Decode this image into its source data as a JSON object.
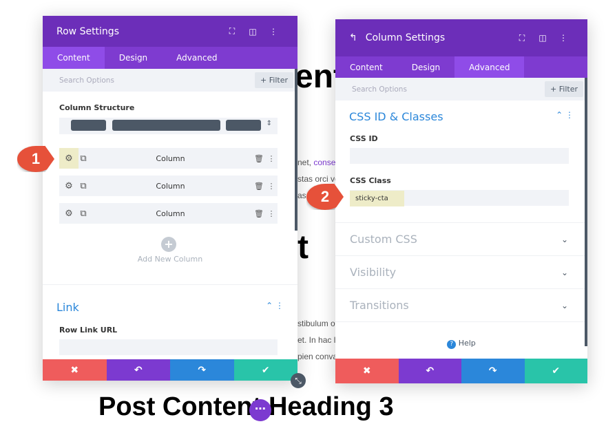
{
  "background": {
    "heading_top": "ent",
    "heading_mid": "t",
    "text_lines": [
      "net, ",
      "conse",
      "stas orci ve",
      "as",
      "stibulum o",
      "et. In hac l",
      "pien conva"
    ],
    "heading_bottom": "Post Content Heading 3"
  },
  "row_settings": {
    "title": "Row Settings",
    "tabs": [
      "Content",
      "Design",
      "Advanced"
    ],
    "search_placeholder": "Search Options",
    "filter": "Filter",
    "column_structure_label": "Column Structure",
    "columns": [
      "Column",
      "Column",
      "Column"
    ],
    "add_column": "Add New Column",
    "link_section": "Link",
    "row_link_url_label": "Row Link URL"
  },
  "column_settings": {
    "title": "Column Settings",
    "tabs": [
      "Content",
      "Design",
      "Advanced"
    ],
    "active_tab": "Advanced",
    "search_placeholder": "Search Options",
    "filter": "Filter",
    "section": "CSS ID & Classes",
    "css_id_label": "CSS ID",
    "css_class_label": "CSS Class",
    "css_class_value": "sticky-cta",
    "collapsed_sections": [
      "Custom CSS",
      "Visibility",
      "Transitions"
    ],
    "help": "Help"
  },
  "badges": [
    "1",
    "2"
  ],
  "colors": {
    "header": "#6c2eb9",
    "tabs": "#7e3bd0",
    "cancel": "#ef5c5c",
    "undo": "#7c3ad0",
    "redo": "#2b87da",
    "save": "#29c4a9",
    "accent": "#2b87da"
  }
}
